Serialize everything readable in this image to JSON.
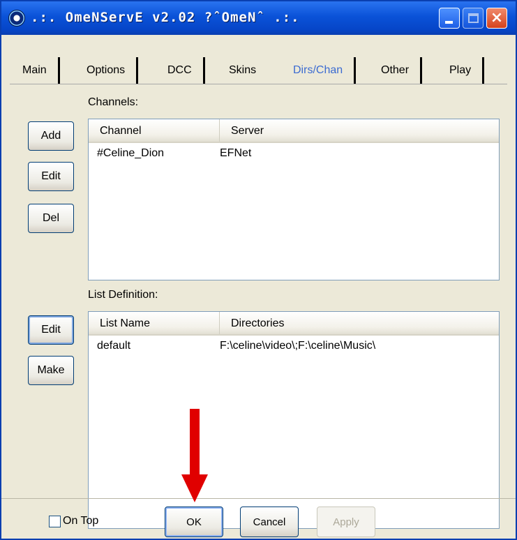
{
  "window": {
    "title": ".:. OmeNServE v2.02 ?ˆOmeNˆ .:."
  },
  "tabs": [
    {
      "label": "Main"
    },
    {
      "label": "Options"
    },
    {
      "label": "DCC"
    },
    {
      "label": "Skins"
    },
    {
      "label": "Dirs/Chan",
      "active": true
    },
    {
      "label": "Other"
    },
    {
      "label": "Play"
    }
  ],
  "channels": {
    "label": "Channels:",
    "buttons": {
      "add": "Add",
      "edit": "Edit",
      "del": "Del"
    },
    "columns": [
      "Channel",
      "Server"
    ],
    "rows": [
      {
        "channel": "#Celine_Dion",
        "server": "EFNet"
      }
    ]
  },
  "list_definition": {
    "label": "List Definition:",
    "buttons": {
      "edit": "Edit",
      "make": "Make"
    },
    "columns": [
      "List Name",
      "Directories"
    ],
    "rows": [
      {
        "name": "default",
        "directories": "F:\\celine\\video\\;F:\\celine\\Music\\"
      }
    ]
  },
  "footer": {
    "on_top_label": "On Top",
    "on_top_checked": false,
    "ok": "OK",
    "cancel": "Cancel",
    "apply": "Apply"
  },
  "colors": {
    "titlebar": "#0a52d8",
    "active_tab": "#3b6bd1",
    "annotation_arrow": "#e00000"
  }
}
